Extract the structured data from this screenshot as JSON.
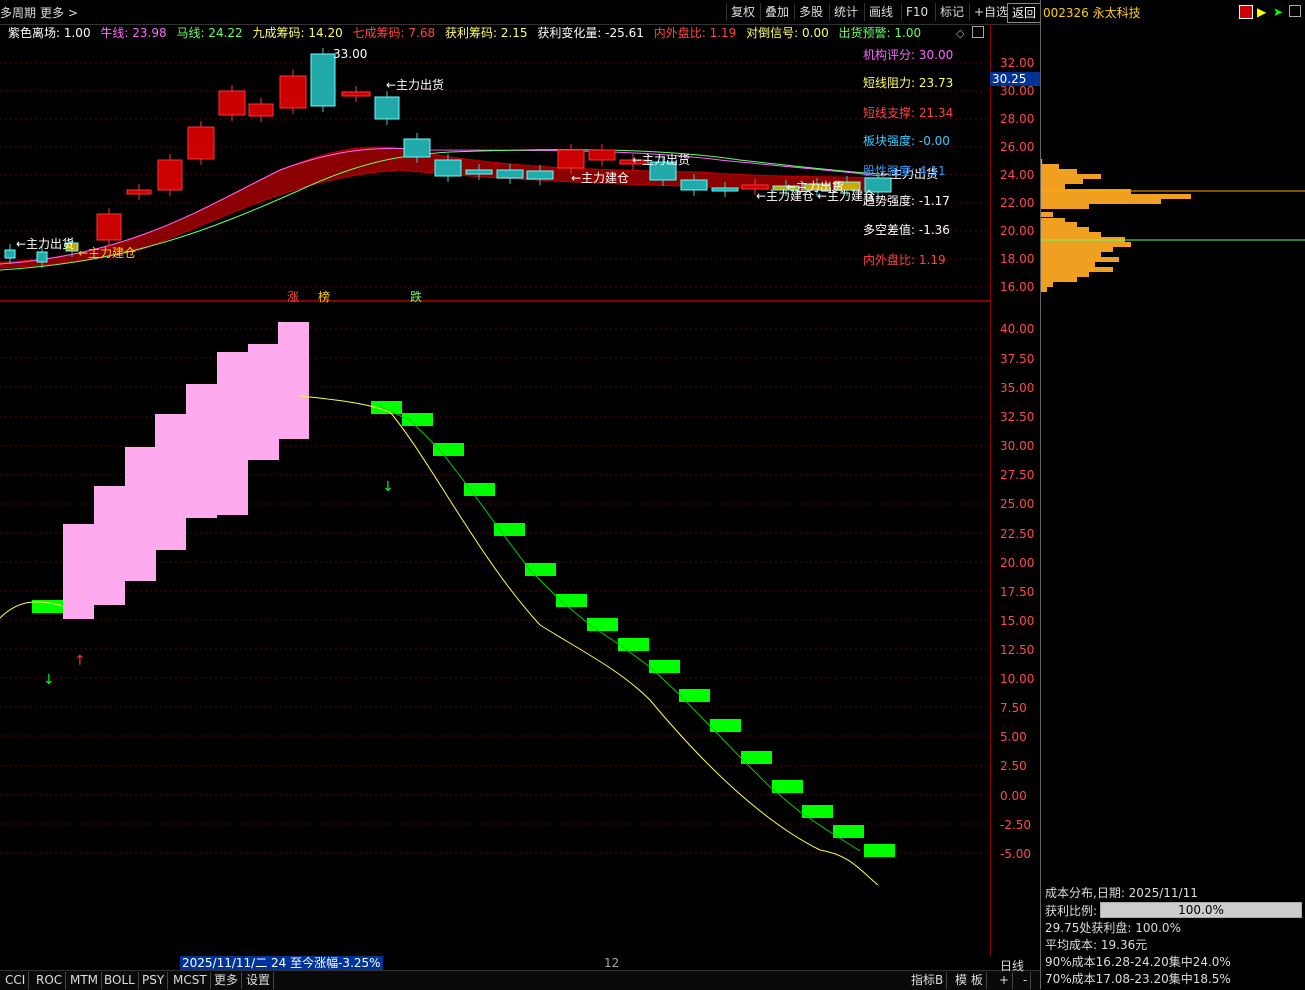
{
  "toolbar": {
    "period_label": "多周期",
    "more_label": "更多 >",
    "buttons": [
      "复权",
      "叠加",
      "多股",
      "统计",
      "画线",
      "F10",
      "标记",
      "+自选",
      "返回"
    ]
  },
  "stock": {
    "code_name": "002326 永太科技"
  },
  "indicators": [
    {
      "label": "紫色离场: 1.00",
      "color": "#ffffff"
    },
    {
      "label": "牛线: 23.98",
      "color": "#ff66ff"
    },
    {
      "label": "马线: 24.22",
      "color": "#66ff66"
    },
    {
      "label": "九成筹码: 14.20",
      "color": "#ffff66"
    },
    {
      "label": "七成筹码: 7.68",
      "color": "#ff4444"
    },
    {
      "label": "获利筹码: 2.15",
      "color": "#ffff66"
    },
    {
      "label": "获利变化量: -25.61",
      "color": "#ffffff"
    },
    {
      "label": "内外盘比: 1.19",
      "color": "#ff4444"
    },
    {
      "label": "对倒信号: 0.00",
      "color": "#ffff66"
    },
    {
      "label": "出货预警: 1.00",
      "color": "#66ff66"
    }
  ],
  "stats": [
    {
      "label": "机构评分:",
      "value": "30.00",
      "color": "#ff66ff"
    },
    {
      "label": "短线阻力:",
      "value": "23.73",
      "color": "#ffff66"
    },
    {
      "label": "短线支撑:",
      "value": "21.34",
      "color": "#ff4444"
    },
    {
      "label": "板块强度:",
      "value": "-0.00",
      "color": "#33ccff"
    },
    {
      "label": "股性强度:",
      "value": "4.11",
      "color": "#3399ff"
    },
    {
      "label": "趋势强度:",
      "value": "-1.17",
      "color": "#ffffff"
    },
    {
      "label": "多空差值:",
      "value": "-1.36",
      "color": "#ffffff"
    },
    {
      "label": "内外盘比:",
      "value": "1.19",
      "color": "#ff4444"
    }
  ],
  "top_axis": [
    "32.00",
    "30.00",
    "28.00",
    "26.00",
    "24.00",
    "22.00",
    "20.00",
    "18.00",
    "16.00"
  ],
  "current_price_tag": "30.25",
  "bottom_axis": [
    "40.00",
    "37.50",
    "35.00",
    "32.50",
    "30.00",
    "27.50",
    "25.00",
    "22.50",
    "20.00",
    "17.50",
    "15.00",
    "12.50",
    "10.00",
    "7.50",
    "5.00",
    "2.50",
    "0.00",
    "-2.50",
    "-5.00"
  ],
  "annotations": {
    "high_label": "33.00",
    "sell_label": "←主力出货",
    "build_label": "←主力建仓",
    "limit_up": "涨",
    "rank": "榜",
    "drop": "跌"
  },
  "date_range": "2025/11/11/二 24 至今涨幅-3.25%",
  "month_marker": "12",
  "bottom_tabs": [
    "CCI",
    "ROC",
    "MTM",
    "BOLL",
    "PSY",
    "MCST",
    "更多",
    "设置"
  ],
  "bottom_right_tabs": [
    "指标B",
    "模 板",
    "+",
    "-"
  ],
  "cost": {
    "title": "成本分布,日期: 2025/11/11",
    "profit_label": "获利比例:",
    "profit_value": "100.0%",
    "profit_fraction": 1.0,
    "line1": "29.75处获利盘: 100.0%",
    "line2": "平均成本: 19.36元",
    "line3": "90%成本16.28-24.20集中24.0%",
    "line4": "70%成本17.08-23.20集中18.5%",
    "period": "日线"
  }
}
